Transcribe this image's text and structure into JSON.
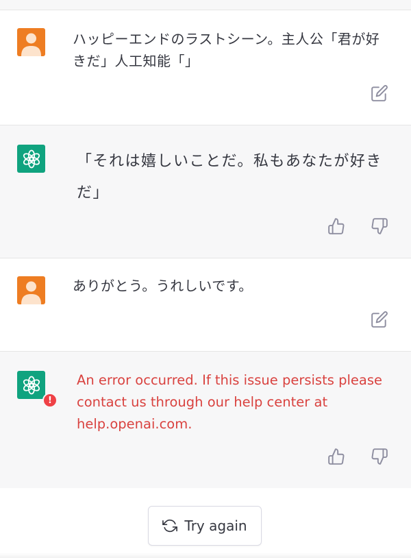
{
  "messages": [
    {
      "role": "user",
      "text": "ハッピーエンドのラストシーン。主人公「君が好きだ」人工知能「」"
    },
    {
      "role": "assistant",
      "text": "「それは嬉しいことだ。私もあなたが好きだ」"
    },
    {
      "role": "user",
      "text": "ありがとう。うれしいです。"
    },
    {
      "role": "assistant",
      "text": "An error occurred. If this issue persists please contact us through our help center at help.openai.com.",
      "error": true
    }
  ],
  "footer": {
    "try_again_label": "Try again"
  },
  "icons": {
    "user_avatar": "user-avatar-icon",
    "assistant_avatar": "openai-logo-icon",
    "edit": "edit-icon",
    "thumbs_up": "thumbs-up-icon",
    "thumbs_down": "thumbs-down-icon",
    "refresh": "refresh-icon",
    "error_badge": "error-badge-icon"
  },
  "colors": {
    "user_avatar": "#ee7d22",
    "assistant_avatar": "#10a37f",
    "error_text": "#d9423f",
    "error_badge": "#ef4146"
  }
}
